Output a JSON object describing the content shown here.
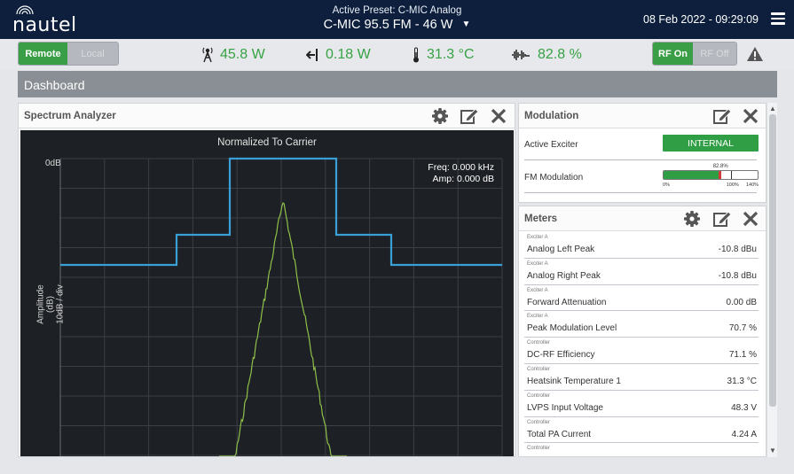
{
  "header": {
    "logo_text": "nautel",
    "preset_label": "Active Preset: C-MIC Analog",
    "preset_value": "C-MIC 95.5 FM - 46 W",
    "datetime": "08 Feb 2022 - 09:29:09"
  },
  "status": {
    "remote_label": "Remote",
    "local_label": "Local",
    "forward_power": "45.8 W",
    "reflected_power": "0.18 W",
    "temperature": "31.3 °C",
    "modulation": "82.8 %",
    "rf_on_label": "RF On",
    "rf_off_label": "RF Off",
    "metric_color": "#36a244"
  },
  "dashboard": {
    "title": "Dashboard"
  },
  "spectrum": {
    "title": "Spectrum Analyzer",
    "plot_title": "Normalized To Carrier",
    "ytick": "0dB",
    "ylabel_line1": "Amplitude (dB)",
    "ylabel_line2": "10dB / div",
    "freq": "Freq: 0.000 kHz",
    "amp": "Amp: 0.000 dB",
    "mask_color": "#3a9fd6",
    "trace_color": "#8fc04a"
  },
  "modulation": {
    "title": "Modulation",
    "active_exciter_label": "Active Exciter",
    "active_exciter_value": "INTERNAL",
    "fm_label": "FM Modulation",
    "fm_value_label": "82.8%",
    "fm_percent": 82.8,
    "scale": [
      "0%",
      "100%",
      "140%"
    ]
  },
  "meters": {
    "title": "Meters",
    "items": [
      {
        "source": "Exciter A",
        "name": "Analog Left Peak",
        "value": "-10.8 dBu"
      },
      {
        "source": "Exciter A",
        "name": "Analog Right Peak",
        "value": "-10.8 dBu"
      },
      {
        "source": "Exciter A",
        "name": "Forward Attenuation",
        "value": "0.00 dB"
      },
      {
        "source": "Exciter A",
        "name": "Peak Modulation Level",
        "value": "70.7 %"
      },
      {
        "source": "Controller",
        "name": "DC-RF Efficiency",
        "value": "71.1 %"
      },
      {
        "source": "Controller",
        "name": "Heatsink Temperature 1",
        "value": "31.3 °C"
      },
      {
        "source": "Controller",
        "name": "LVPS Input Voltage",
        "value": "48.3 V"
      },
      {
        "source": "Controller",
        "name": "Total PA Current",
        "value": "4.24 A"
      },
      {
        "source": "Controller",
        "name": "",
        "value": ""
      }
    ]
  }
}
